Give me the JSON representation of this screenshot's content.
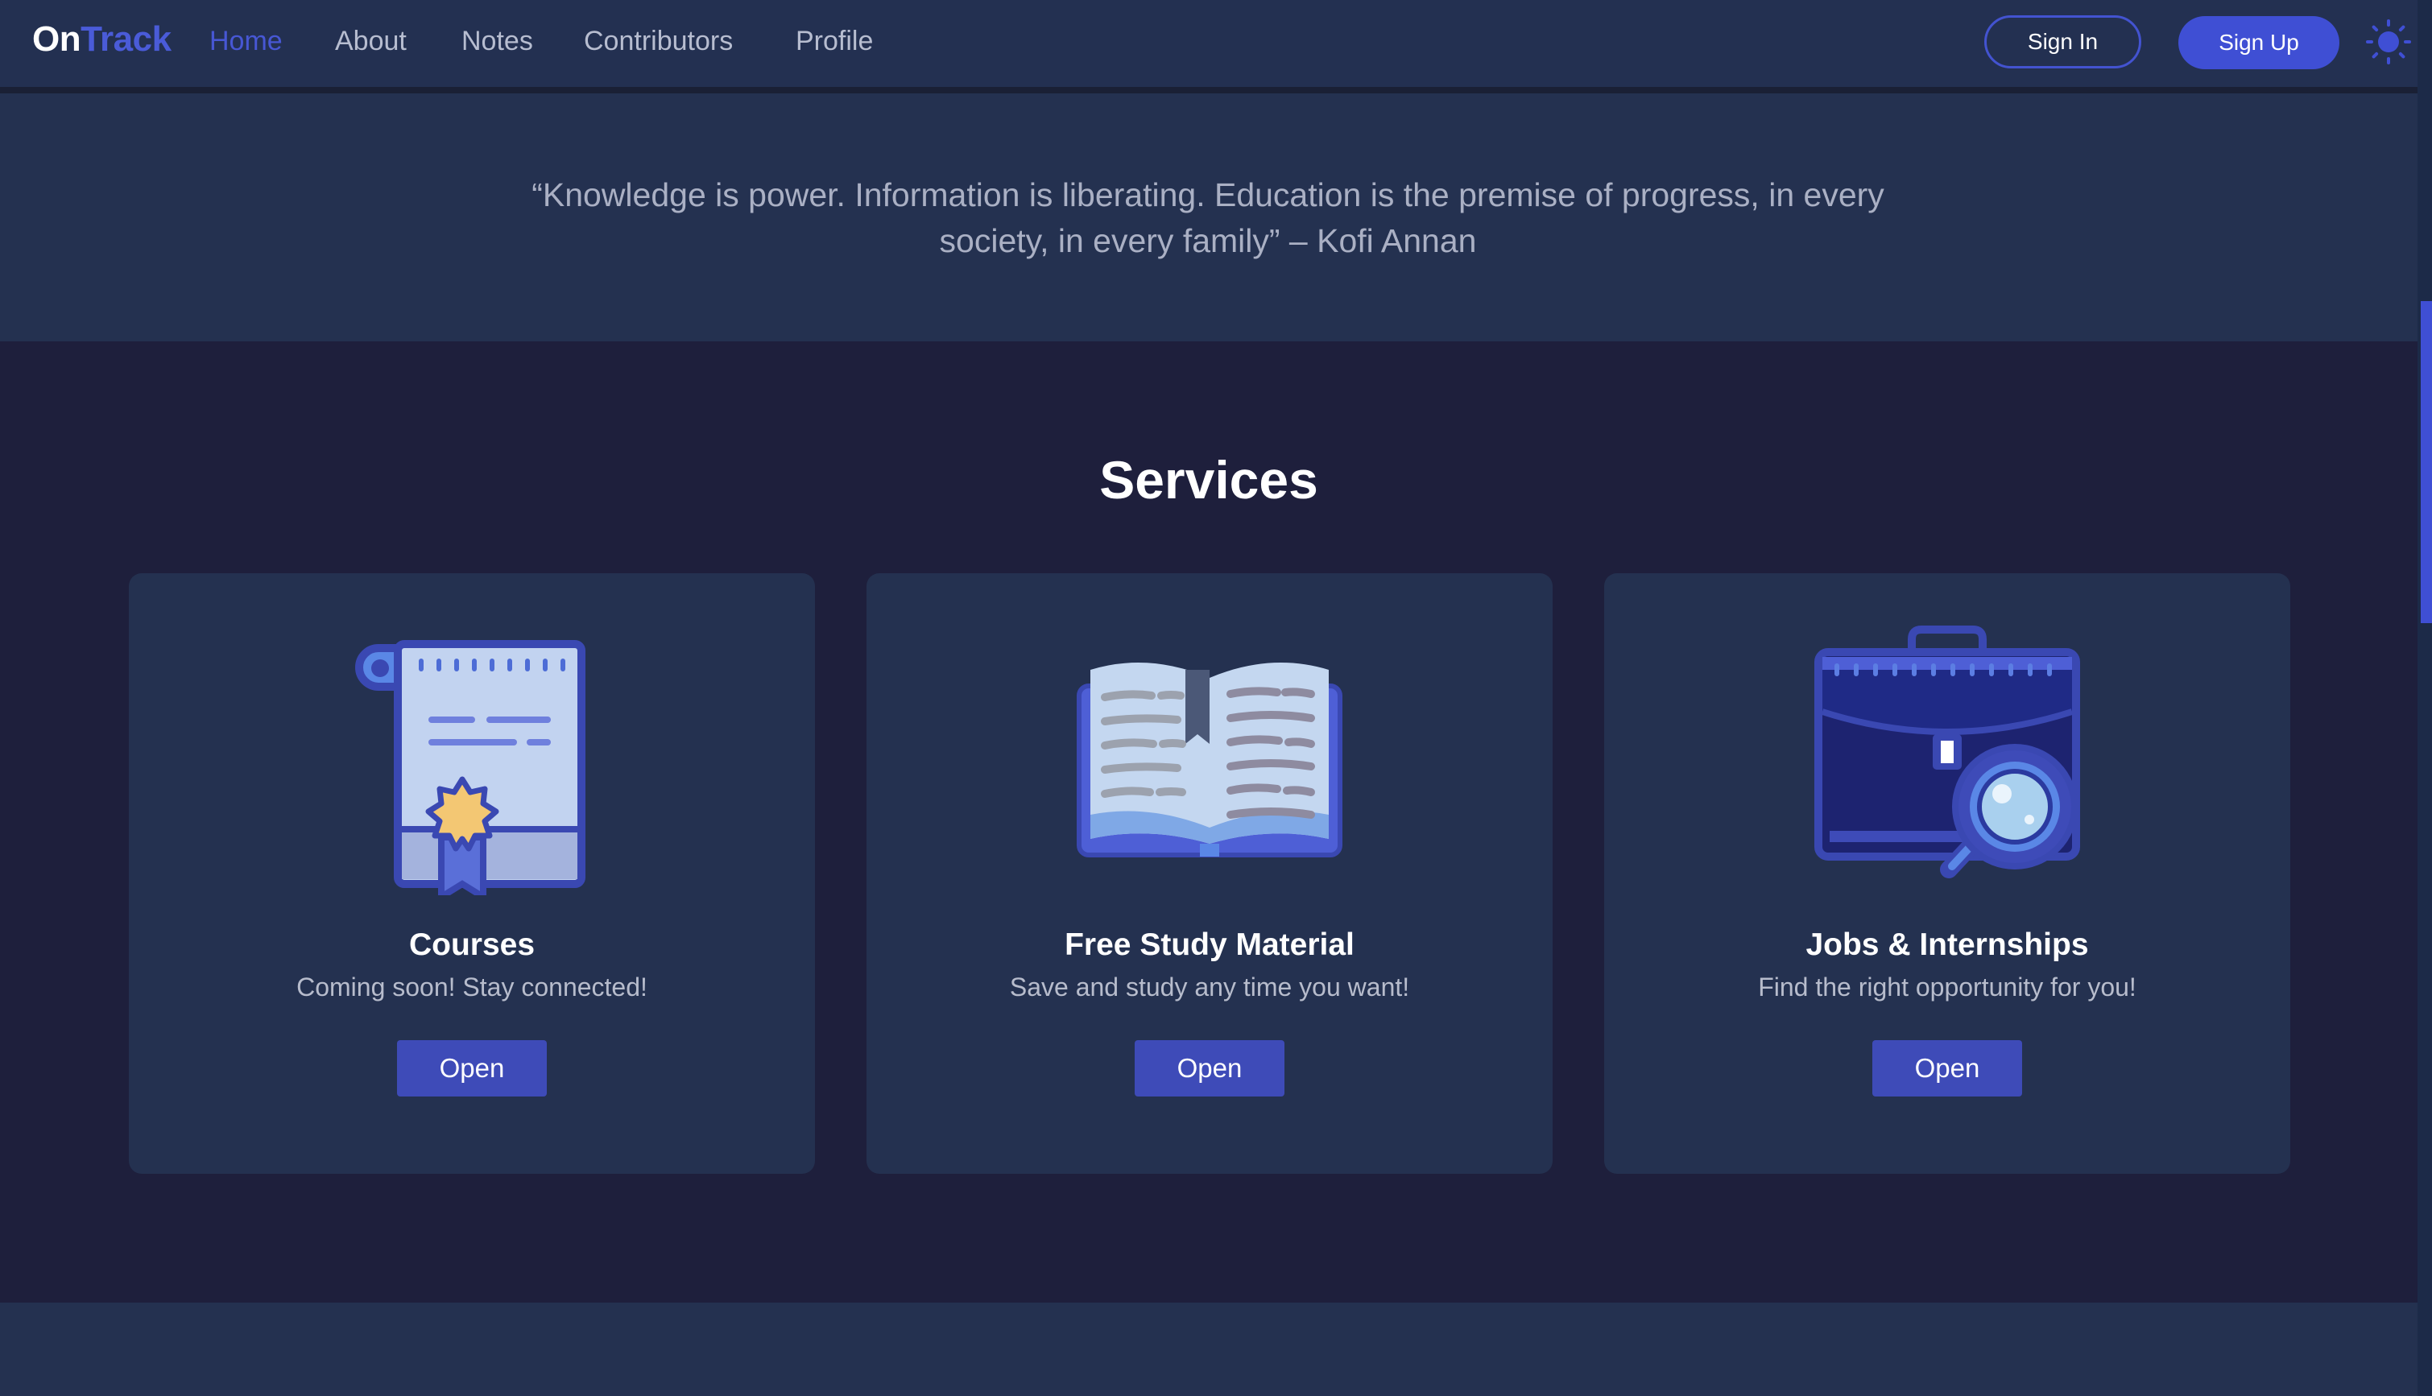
{
  "nav": {
    "logo_part1": "On",
    "logo_part2": "Track",
    "links": [
      "Home",
      "About",
      "Notes",
      "Contributors",
      "Profile"
    ],
    "active_link": "Home",
    "signin_label": "Sign In",
    "signup_label": "Sign Up",
    "theme_icon": "sun-icon"
  },
  "quote": {
    "line1": "“Knowledge is power. Information is liberating. Education is the premise of progress, in every",
    "line2": "society, in every family” – Kofi Annan"
  },
  "services": {
    "title": "Services",
    "cards": [
      {
        "icon": "certificate-icon",
        "title": "Courses",
        "description": "Coming soon! Stay connected!",
        "button_label": "Open"
      },
      {
        "icon": "open-book-icon",
        "title": "Free Study Material",
        "description": "Save and study any time you want!",
        "button_label": "Open"
      },
      {
        "icon": "briefcase-search-icon",
        "title": "Jobs & Internships",
        "description": "Find the right opportunity for you!",
        "button_label": "Open"
      }
    ]
  },
  "colors": {
    "accent": "#3f4fd4",
    "navbar_bg": "#233051",
    "services_bg": "#1e1f3c",
    "card_bg": "#243150"
  }
}
